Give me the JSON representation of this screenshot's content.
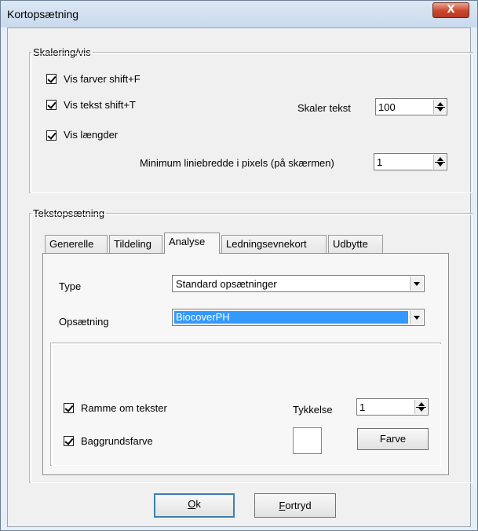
{
  "window": {
    "title": "Kortopsætning",
    "close_glyph": "X"
  },
  "scaling": {
    "group_label": "Skalering/vis",
    "show_colors": {
      "label": "Vis farver  shift+F",
      "checked": true
    },
    "show_text": {
      "label": "Vis tekst  shift+T",
      "checked": true
    },
    "show_lengths": {
      "label": "Vis længder",
      "checked": true
    },
    "scale_text_label": "Skaler tekst",
    "scale_text_value": "100",
    "min_line_width_label": "Minimum liniebredde i pixels (på skærmen)",
    "min_line_width_value": "1"
  },
  "text_setup": {
    "group_label": "Tekstopsætning",
    "tabs": [
      "Generelle",
      "Tildeling",
      "Analyse",
      "Ledningsevnekort",
      "Udbytte"
    ],
    "active_tab": "Analyse",
    "type_label": "Type",
    "type_value": "Standard opsætninger",
    "setup_label": "Opsætning",
    "setup_value": "BiocoverPH",
    "frame_text": {
      "label": "Ramme om tekster",
      "checked": true
    },
    "thickness_label": "Tykkelse",
    "thickness_value": "1",
    "background_color": {
      "label": "Baggrundsfarve",
      "checked": true
    },
    "background_swatch_color": "#ffffff",
    "color_button": "Farve"
  },
  "buttons": {
    "ok": "Ok",
    "cancel": "Fortryd"
  }
}
